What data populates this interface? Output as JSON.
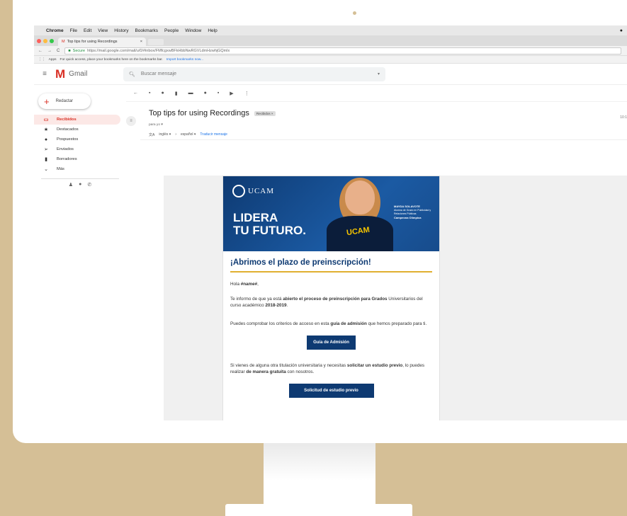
{
  "menubar": {
    "app": "Chrome",
    "items": [
      "File",
      "Edit",
      "View",
      "History",
      "Bookmarks",
      "People",
      "Window",
      "Help"
    ]
  },
  "browser": {
    "tab_title": "Top tips for using Recordings",
    "secure_label": "Secure",
    "url": "https://mail.google.com/mail/u/0/#inbox/FMfcgxwBFkHbbNwRGVLdmHzwhjGQmlx",
    "bookmarks_apps": "Apps",
    "bookmarks_hint": "For quick access, place your bookmarks here on the bookmarks bar.",
    "bookmarks_link": "Import bookmarks now..."
  },
  "gmail": {
    "logo_text": "Gmail",
    "search_placeholder": "Buscar mensaje",
    "compose": "Redactar",
    "nav": [
      {
        "label": "Recibidos",
        "icon": "inbox-icon"
      },
      {
        "label": "Destacados",
        "icon": "star-icon"
      },
      {
        "label": "Pospuestos",
        "icon": "clock-icon"
      },
      {
        "label": "Enviados",
        "icon": "send-icon"
      },
      {
        "label": "Borradores",
        "icon": "draft-icon"
      },
      {
        "label": "Más",
        "icon": "chevron-down-icon"
      }
    ]
  },
  "message": {
    "subject": "Top tips for using Recordings",
    "label": "Recibidos",
    "date": "10:1",
    "recipient": "para yo",
    "translate_from": "inglés",
    "translate_to": "español",
    "translate_link": "Traducir mensaje"
  },
  "email": {
    "logo": "UCAM",
    "banner_line1": "LIDERA",
    "banner_line2": "TU FUTURO.",
    "shirt_text": "UCAM",
    "caption_name": "MAYDA SOLAVOTE",
    "caption_lines": "Alumna de Grado en Publicidad y Relaciones Públicas",
    "caption_campus": "Campeona Olímpica",
    "heading": "¡Abrimos el plazo de preinscripción!",
    "greeting_prefix": "Hola ",
    "greeting_name": "#name#",
    "greeting_suffix": ",",
    "p1_a": "Te informo de que ya está ",
    "p1_b": "abierto el proceso de preinscripción para Grados",
    "p1_c": " Universitarios del curso académico ",
    "p1_d": "2018-2019",
    "p1_e": ".",
    "p2_a": "Puedes comprobar los criterios de acceso en esta ",
    "p2_b": "guía de admisión",
    "p2_c": " que hemos preparado para ti.",
    "button1": "Guía de Admisión",
    "p3_a": "Si vienes de alguna otra titulación universitaria y necesitas ",
    "p3_b": "solicitar un estudio previo",
    "p3_c": ", lo puedes realizar ",
    "p3_d": "de manera gratuita",
    "p3_e": " con nosotros.",
    "button2": "Solicitud de estudio previo"
  }
}
